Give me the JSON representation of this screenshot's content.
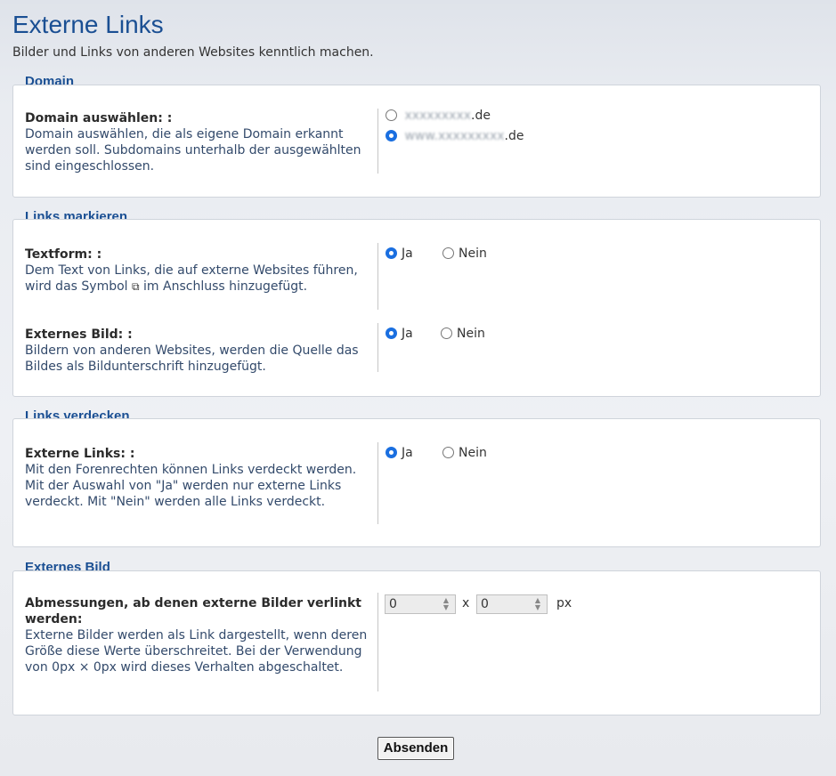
{
  "page": {
    "title": "Externe Links",
    "subtitle": "Bilder und Links von anderen Websites kenntlich machen."
  },
  "sections": {
    "domain": {
      "title": "Domain",
      "label": "Domain auswählen: :",
      "description": "Domain auswählen, die als eigene Domain erkannt werden soll. Subdomains unterhalb der ausgewählten sind eingeschlossen.",
      "options": [
        {
          "prefix": "xxxxxxxxx",
          "suffix": ".de",
          "checked": false
        },
        {
          "prefix": "www.xxxxxxxxx",
          "suffix": ".de",
          "checked": true
        }
      ]
    },
    "links_markieren": {
      "title": "Links markieren",
      "textform": {
        "label": "Textform: :",
        "description_before": "Dem Text von Links, die auf externe Websites führen, wird das Symbol",
        "description_after": "im Anschluss hinzugefügt.",
        "yes": "Ja",
        "no": "Nein",
        "value": "Ja"
      },
      "externes_bild": {
        "label": "Externes Bild: :",
        "description": "Bildern von anderen Websites, werden die Quelle das Bildes als Bildunterschrift hinzugefügt.",
        "yes": "Ja",
        "no": "Nein",
        "value": "Ja"
      }
    },
    "links_verdecken": {
      "title": "Links verdecken",
      "label": "Externe Links: :",
      "description": "Mit den Forenrechten können Links verdeckt werden. Mit der Auswahl von \"Ja\" werden nur externe Links verdeckt. Mit \"Nein\" werden alle Links verdeckt.",
      "yes": "Ja",
      "no": "Nein",
      "value": "Ja"
    },
    "externes_bild": {
      "title": "Externes Bild",
      "label": "Abmessungen, ab denen externe Bilder verlinkt werden:",
      "description": "Externe Bilder werden als Link dargestellt, wenn deren Größe diese Werte überschreitet. Bei der Verwendung von 0px × 0px wird dieses Verhalten abgeschaltet.",
      "width_value": "0",
      "height_value": "0",
      "separator": "x",
      "unit": "px"
    }
  },
  "submit_label": "Absenden",
  "colors": {
    "title": "#1a4f93",
    "radio_checked": "#1a6fe0"
  },
  "icons": {
    "external_link": "external-link-icon"
  }
}
